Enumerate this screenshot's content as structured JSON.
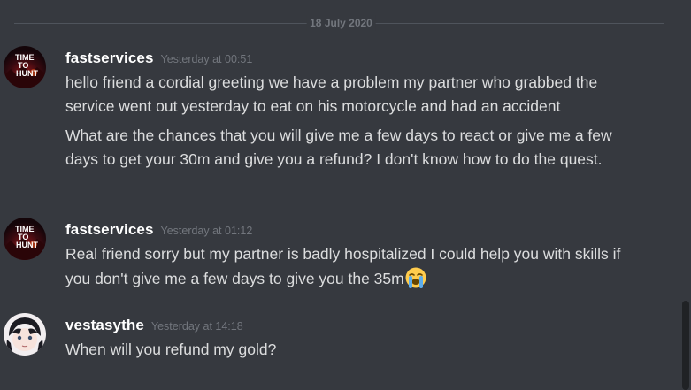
{
  "date_divider": "18 July 2020",
  "messages": [
    {
      "username": "fastservices",
      "timestamp": "Yesterday at 00:51",
      "avatar_icon": "time-to-hunt-avatar",
      "lines": [
        "hello friend a cordial greeting we have a problem my partner who grabbed the service went out yesterday to eat on his motorcycle and had an accident",
        "What are the chances that you will give me a few days to react or give me a few days to get your 30m and give you a refund? I don't know how to do the quest."
      ]
    },
    {
      "username": "fastservices",
      "timestamp": "Yesterday at 01:12",
      "avatar_icon": "time-to-hunt-avatar",
      "lines": [
        "Real friend sorry but my partner is badly hospitalized I could help you with skills if you don't give me a few days to give you the 35m"
      ],
      "emoji": "loudly-crying-face-emoji"
    },
    {
      "username": "vestasythe",
      "timestamp": "Yesterday at 14:18",
      "avatar_icon": "anime-character-avatar",
      "lines": [
        "When will you refund my gold?"
      ]
    }
  ],
  "colors": {
    "background": "#36393f",
    "username": "#ffffff",
    "text": "#dcddde",
    "muted": "#72767d"
  }
}
